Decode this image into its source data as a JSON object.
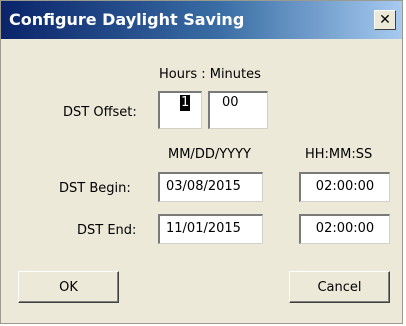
{
  "window": {
    "title": "Configure Daylight Saving",
    "close_glyph": "✕"
  },
  "offset": {
    "header": "Hours : Minutes",
    "label": "DST Offset:",
    "hours": "1",
    "minutes": "00"
  },
  "columns": {
    "date_header": "MM/DD/YYYY",
    "time_header": "HH:MM:SS"
  },
  "begin": {
    "label": "DST Begin:",
    "date": "03/08/2015",
    "time": "02:00:00"
  },
  "end": {
    "label": "DST End:",
    "date": "11/01/2015",
    "time": "02:00:00"
  },
  "buttons": {
    "ok": "OK",
    "cancel": "Cancel"
  }
}
